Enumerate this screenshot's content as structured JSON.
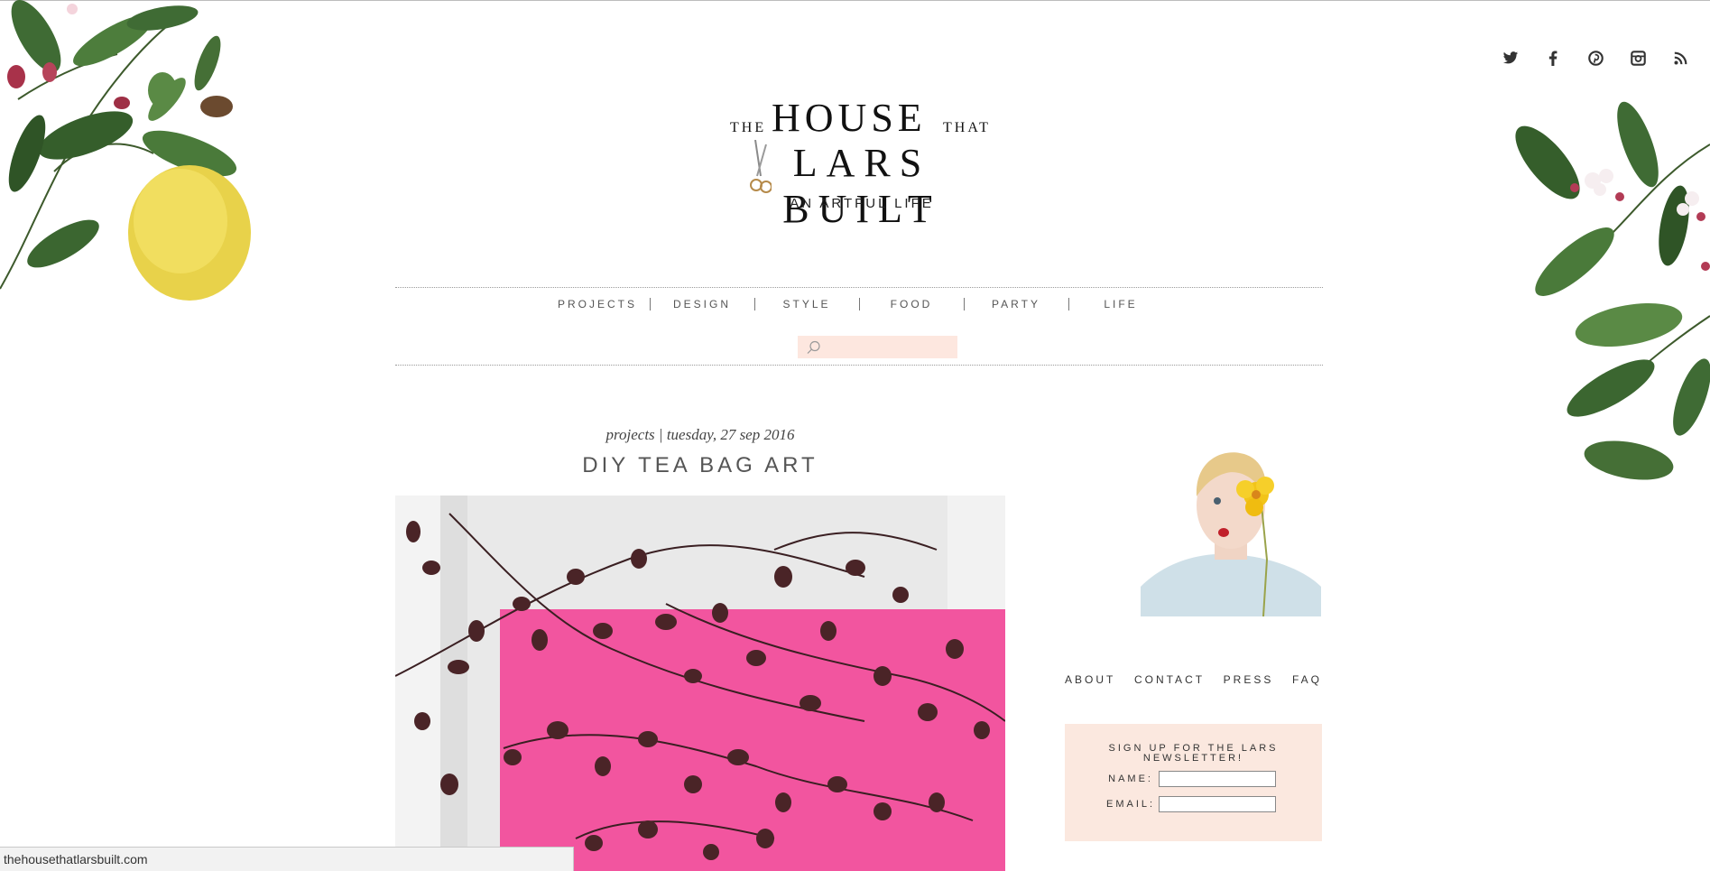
{
  "header": {
    "logo_the": "THE",
    "logo_house": "HOUSE",
    "logo_that": "THAT",
    "logo_lars_built": "LARS BUILT",
    "tagline": "AN ARTFUL LIFE"
  },
  "social": [
    "twitter-icon",
    "facebook-icon",
    "pinterest-icon",
    "instagram-icon",
    "rss-icon"
  ],
  "nav": {
    "items": [
      "PROJECTS",
      "DESIGN",
      "STYLE",
      "FOOD",
      "PARTY",
      "LIFE"
    ],
    "search_placeholder": ""
  },
  "post": {
    "meta": "projects | tuesday, 27 sep 2016",
    "title": "DIY TEA BAG ART"
  },
  "sidebar": {
    "links": [
      "ABOUT",
      "CONTACT",
      "PRESS",
      "FAQ"
    ],
    "newsletter_title": "SIGN UP FOR THE LARS NEWSLETTER!",
    "name_label": "NAME:",
    "email_label": "EMAIL:"
  },
  "status": "thehousethatlarsbuilt.com",
  "colors": {
    "search_bg": "#fde7df",
    "newsletter_bg": "#fbe8df",
    "post_pink": "#f2559f"
  }
}
